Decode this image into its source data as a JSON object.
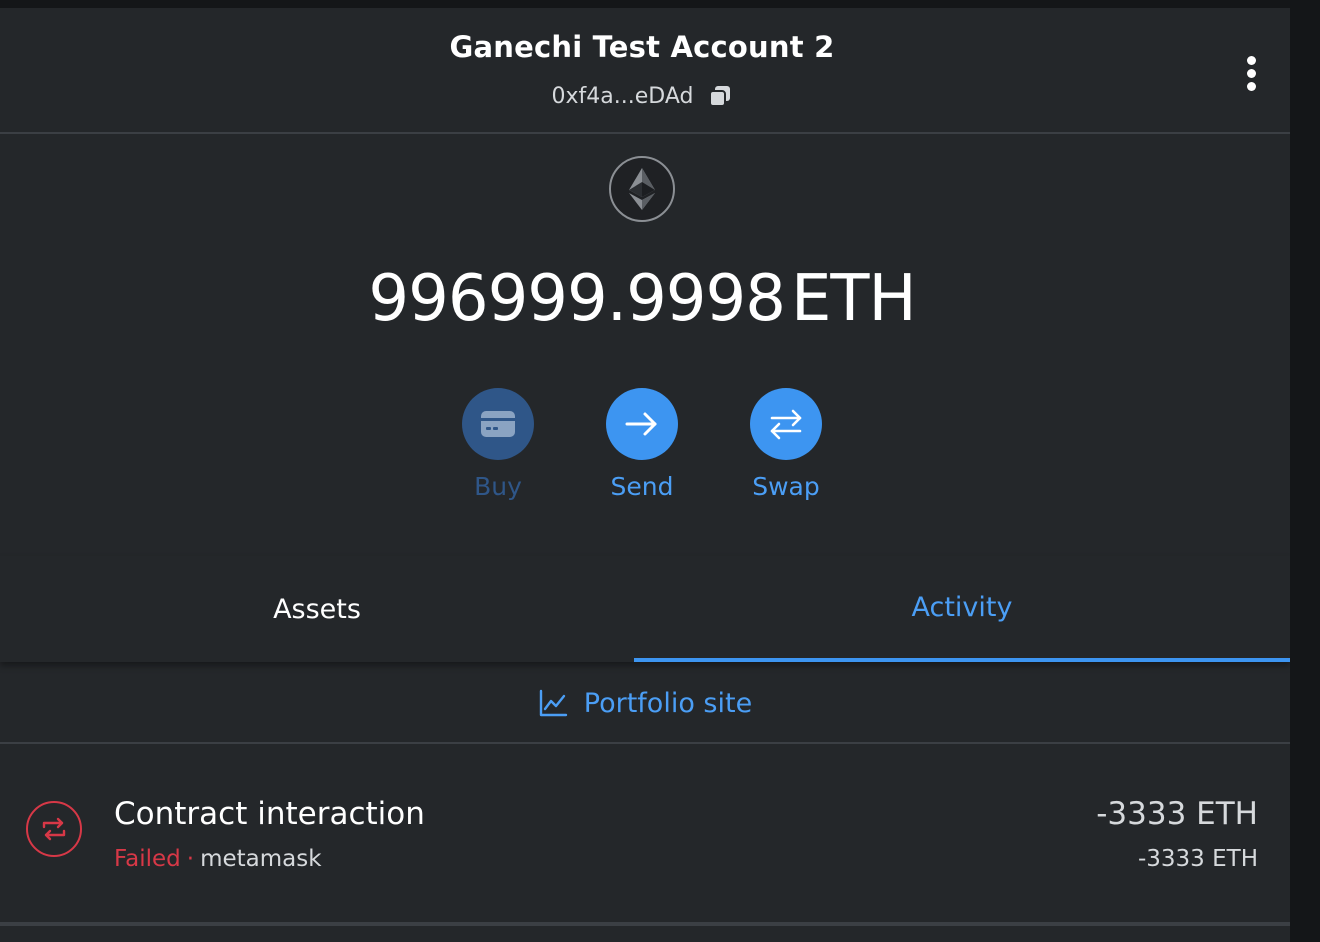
{
  "header": {
    "account_name": "Ganechi Test Account 2",
    "address": "0xf4a...eDAd",
    "copy_icon": "copy-icon",
    "menu_icon": "kebab-menu-icon"
  },
  "balance": {
    "icon": "ethereum-icon",
    "amount": "996999.9998",
    "unit": "ETH"
  },
  "actions": {
    "buy_label": "Buy",
    "send_label": "Send",
    "swap_label": "Swap"
  },
  "tabs": [
    {
      "label": "Assets",
      "active": false
    },
    {
      "label": "Activity",
      "active": true
    }
  ],
  "portfolio": {
    "label": "Portfolio site",
    "icon": "chart-line-icon"
  },
  "transactions": [
    {
      "title": "Contract interaction",
      "status": "Failed",
      "separator": "·",
      "origin": "metamask",
      "primary_amount": "-3333 ETH",
      "secondary_amount": "-3333 ETH",
      "icon": "swap-arrows-icon"
    }
  ],
  "colors": {
    "background": "#24272a",
    "accent": "#3d95f1",
    "buy_disabled": "#2f5688",
    "error": "#d73847",
    "divider": "#3b3f44"
  }
}
